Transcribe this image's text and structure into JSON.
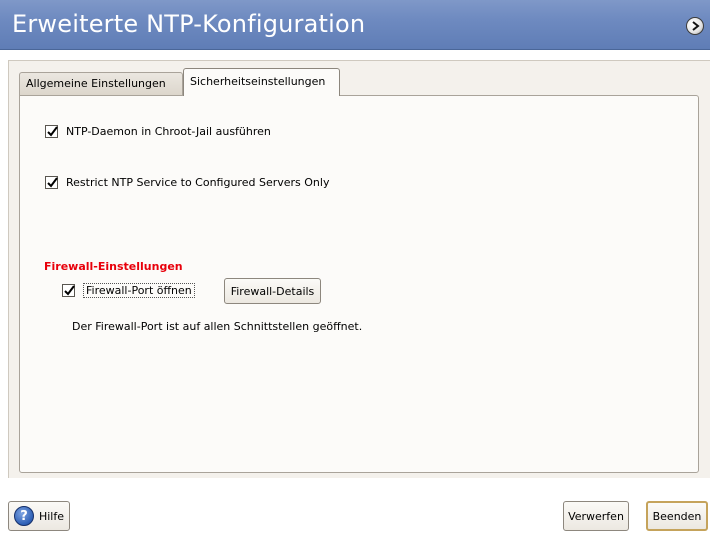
{
  "window": {
    "title": "Erweiterte NTP-Konfiguration"
  },
  "tabs": [
    {
      "label": "Allgemeine Einstellungen",
      "active": false
    },
    {
      "label": "Sicherheitseinstellungen",
      "active": true
    }
  ],
  "options": {
    "chroot": {
      "label": "NTP-Daemon in Chroot-Jail ausführen",
      "checked": true
    },
    "restrict": {
      "label": "Restrict NTP Service to Configured Servers Only",
      "checked": true
    }
  },
  "firewall": {
    "section_title": "Firewall-Einstellungen",
    "open_port": {
      "label": "Firewall-Port öffnen",
      "checked": true
    },
    "details_button": "Firewall-Details",
    "status_text": "Der Firewall-Port ist auf allen Schnittstellen geöffnet."
  },
  "footer": {
    "help_label": "Hilfe",
    "discard_label": "Verwerfen",
    "finish_label": "Beenden"
  },
  "colors": {
    "header": "#6e8ac0",
    "section_title": "#e8000b",
    "default_button_border": "#c5a35b"
  }
}
